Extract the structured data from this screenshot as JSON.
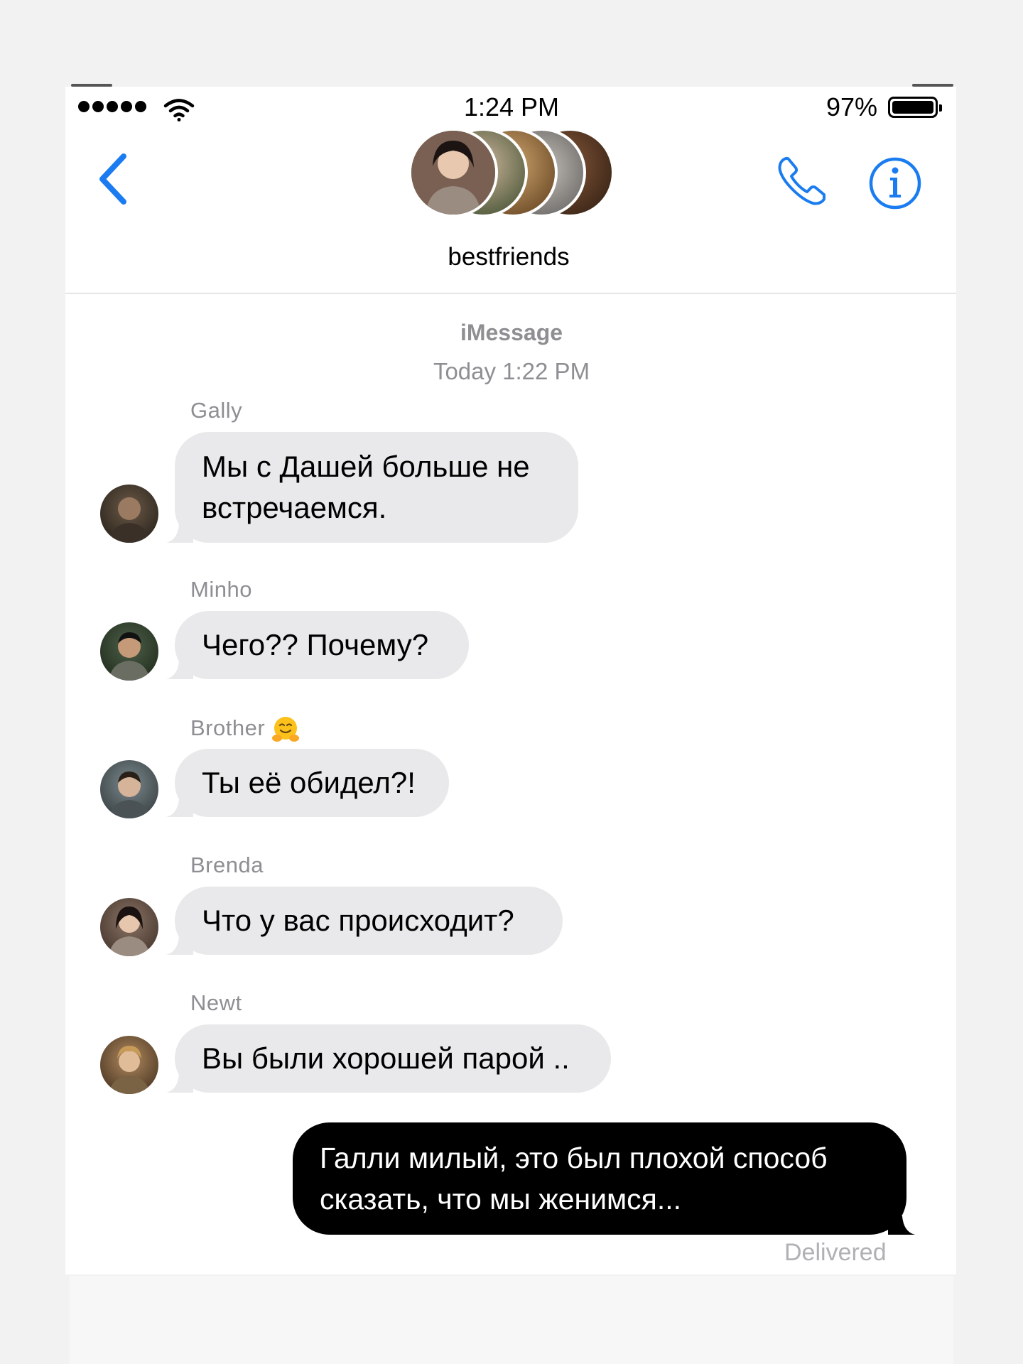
{
  "status_bar": {
    "time": "1:24 PM",
    "battery_percent": "97%",
    "battery_level": 0.97,
    "signal_bars": 5,
    "wifi_icon": "wifi-icon"
  },
  "header": {
    "back_icon": "chevron-left-icon",
    "call_icon": "phone-icon",
    "info_icon": "info-icon",
    "group_name": "bestfriends",
    "accent_color": "#1a7cf0"
  },
  "thread": {
    "service": "iMessage",
    "timestamp": "Today 1:22 PM"
  },
  "messages": [
    {
      "sender": "Gally",
      "text": "Мы с Дашей больше не встречаемся."
    },
    {
      "sender": "Minho",
      "text": "Чего?? Почему?"
    },
    {
      "sender": "Brother",
      "sender_emoji": "hugging-face-icon",
      "text": "Ты её обидел?!"
    },
    {
      "sender": "Brenda",
      "text": "Что у вас происходит?"
    },
    {
      "sender": "Newt",
      "text": "Вы были хорошей парой .."
    }
  ],
  "outgoing": {
    "text": "Галли милый, это был плохой способ сказать, что мы женимся...",
    "status": "Delivered"
  },
  "colors": {
    "incoming_bubble": "#e9e9eb",
    "outgoing_bubble": "#000000",
    "meta_text": "#8e8e93"
  }
}
